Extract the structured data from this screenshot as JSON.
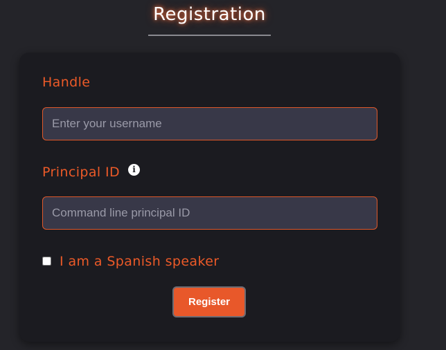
{
  "page": {
    "title": "Registration"
  },
  "form": {
    "handle": {
      "label": "Handle",
      "placeholder": "Enter your username",
      "value": ""
    },
    "principal_id": {
      "label": "Principal ID",
      "info_icon": "i",
      "placeholder": "Command line principal ID",
      "value": ""
    },
    "spanish_speaker": {
      "label": "I am a Spanish speaker",
      "checked": false
    },
    "submit_label": "Register"
  },
  "colors": {
    "background": "#242429",
    "card": "#1b1b20",
    "accent": "#e8582a",
    "input_background": "#383848"
  }
}
